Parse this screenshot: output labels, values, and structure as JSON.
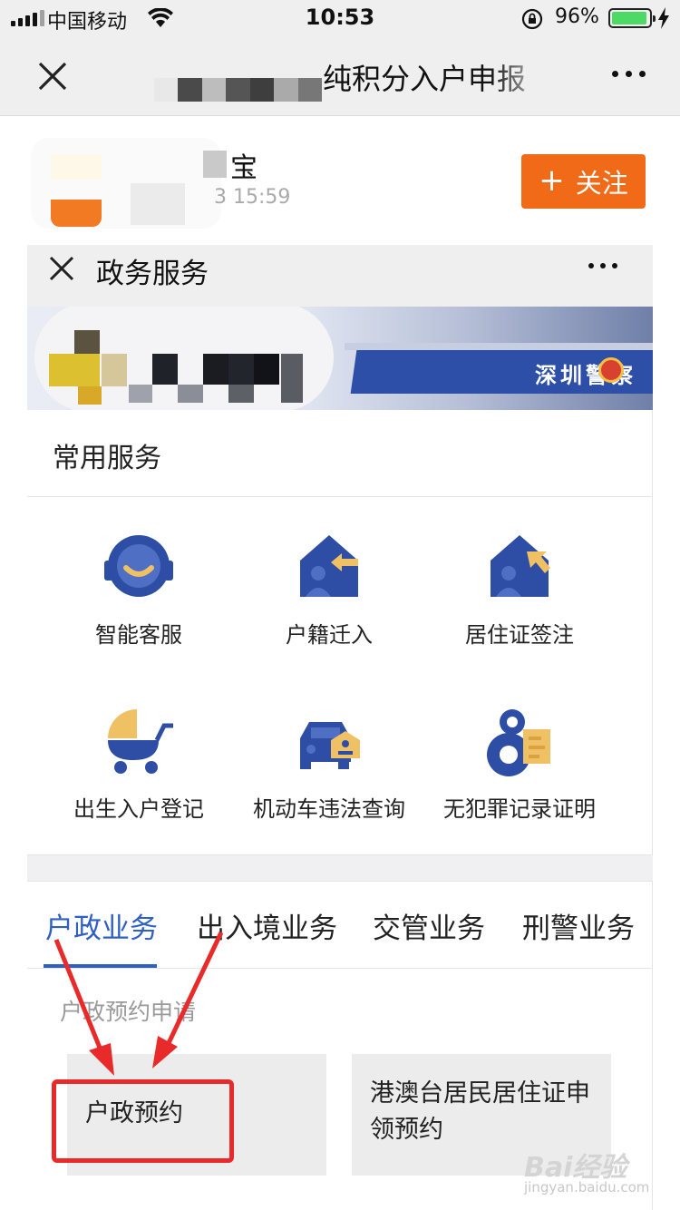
{
  "status_bar": {
    "carrier": "中国移动",
    "time": "10:53",
    "battery_percent": "96%",
    "battery_level": 0.96
  },
  "nav": {
    "title": "纯积分入户申报",
    "close_icon": "close-icon",
    "more_icon": "more-icon"
  },
  "author": {
    "name_visible": "宝",
    "date_visible": "3 15:59",
    "follow_label": "关注",
    "follow_color": "#f06a18"
  },
  "card": {
    "title": "政务服务",
    "banner_text": "深圳警察",
    "section_title": "常用服务",
    "services": [
      {
        "label": "智能客服",
        "icon": "customer-service-icon"
      },
      {
        "label": "户籍迁入",
        "icon": "household-transfer-icon"
      },
      {
        "label": "居住证签注",
        "icon": "residence-permit-icon"
      },
      {
        "label": "出生入户登记",
        "icon": "baby-stroller-icon"
      },
      {
        "label": "机动车违法查询",
        "icon": "car-violation-icon"
      },
      {
        "label": "无犯罪记录证明",
        "icon": "no-crime-record-icon"
      }
    ],
    "tabs": [
      {
        "label": "户政业务",
        "active": true
      },
      {
        "label": "出入境业务",
        "active": false
      },
      {
        "label": "交管业务",
        "active": false
      },
      {
        "label": "刑警业务",
        "active": false
      }
    ],
    "sub_section": "户政预约申请",
    "tiles": [
      {
        "label": "户政预约"
      },
      {
        "label_line1": "港澳台居民居住证申",
        "label_line2": "领预约"
      }
    ],
    "accent_color": "#2e5fc7",
    "annotation_color": "#e82a2a"
  },
  "watermark": {
    "brand": "Bai经验",
    "url": "jingyan.baidu.com"
  }
}
